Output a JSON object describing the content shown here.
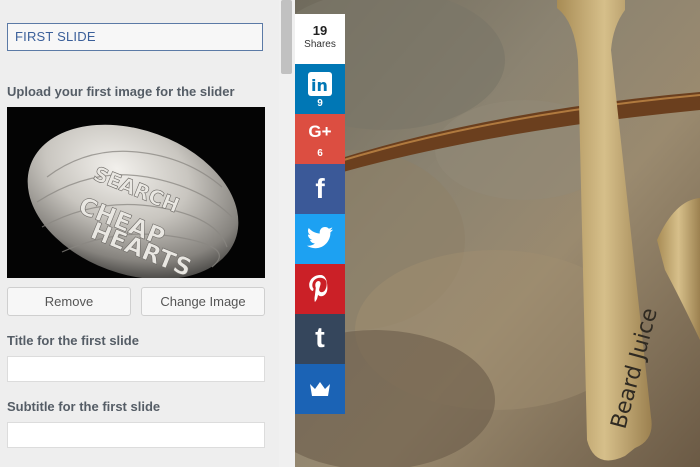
{
  "customizer": {
    "slide_heading": "FIRST SLIDE",
    "upload_label": "Upload your first image for the slider",
    "remove_label": "Remove",
    "change_image_label": "Change Image",
    "title_label": "Title for the first slide",
    "title_value": "",
    "subtitle_label": "Subtitle for the first slide",
    "subtitle_value": "",
    "image_text": [
      "CHEAP",
      "SEARCH",
      "HEARTS"
    ]
  },
  "share_bar": {
    "total_count": "19",
    "total_label": "Shares",
    "buttons": [
      {
        "network": "linkedin",
        "icon": "linkedin-icon",
        "glyph": "in",
        "count": "9",
        "color": "#0077b5"
      },
      {
        "network": "google-plus",
        "icon": "google-plus-icon",
        "glyph": "G+",
        "count": "6",
        "color": "#dc4e41"
      },
      {
        "network": "facebook",
        "icon": "facebook-icon",
        "glyph": "f",
        "count": "",
        "color": "#3b5998"
      },
      {
        "network": "twitter",
        "icon": "twitter-icon",
        "glyph": "",
        "count": "",
        "color": "#1da1f2"
      },
      {
        "network": "pinterest",
        "icon": "pinterest-icon",
        "glyph": "P",
        "count": "",
        "color": "#cb2027"
      },
      {
        "network": "tumblr",
        "icon": "tumblr-icon",
        "glyph": "t",
        "count": "",
        "color": "#35465c"
      },
      {
        "network": "sumome",
        "icon": "crown-icon",
        "glyph": "",
        "count": "",
        "color": "#1b63b5"
      }
    ]
  },
  "photo": {
    "sign_text": "Beard Juice"
  }
}
